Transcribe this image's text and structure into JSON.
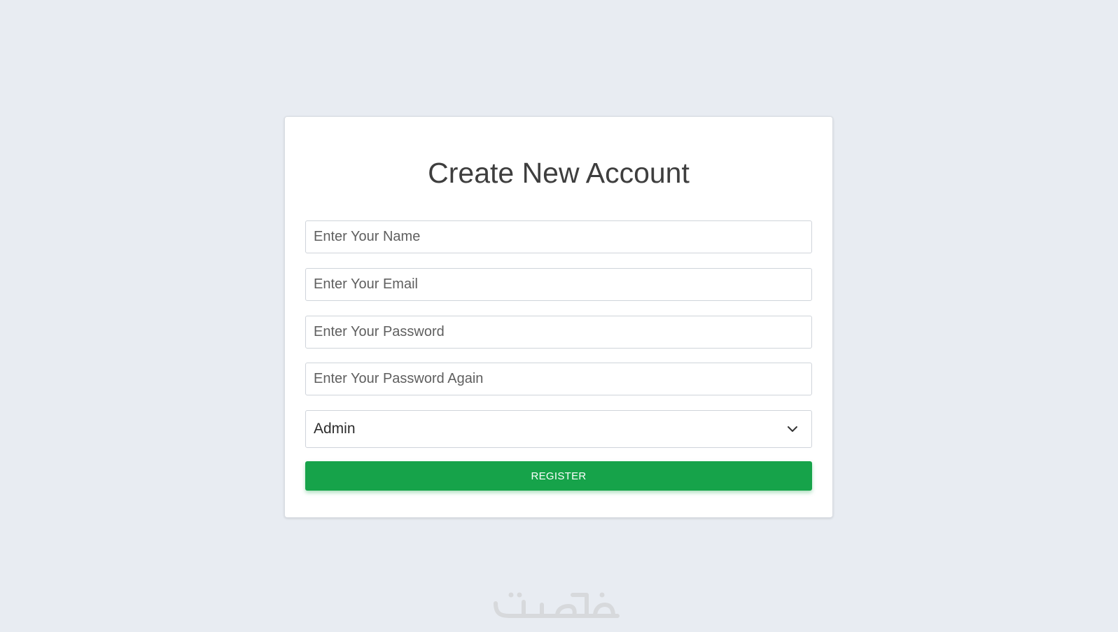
{
  "form": {
    "title": "Create New Account",
    "name_placeholder": "Enter Your Name",
    "email_placeholder": "Enter Your Email",
    "password_placeholder": "Enter Your Password",
    "password_again_placeholder": "Enter Your Password Again",
    "role_selected": "Admin",
    "register_label": "REGISTER"
  },
  "watermark": {
    "text": "خمسات",
    "icon": "khamsat-logo"
  },
  "colors": {
    "background": "#e8ecf2",
    "card": "#ffffff",
    "accent": "#16a34a",
    "title": "#3e3e3e"
  }
}
